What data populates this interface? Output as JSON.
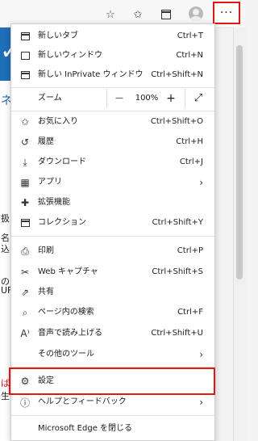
{
  "toolbar": {
    "icons": [
      "add-to-favorites-icon",
      "favorites-icon",
      "collections-icon",
      "profile-icon",
      "more-icon"
    ],
    "more_label": "···"
  },
  "page": {
    "fragments": [
      "ネ",
      "扱",
      "名",
      "込",
      "の",
      "UF",
      "ば",
      "生"
    ]
  },
  "menu": {
    "new_tab": {
      "label": "新しいタブ",
      "shortcut": "Ctrl+T"
    },
    "new_window": {
      "label": "新しいウィンドウ",
      "shortcut": "Ctrl+N"
    },
    "new_inprivate": {
      "label": "新しい InPrivate ウィンドウ",
      "shortcut": "Ctrl+Shift+N"
    },
    "zoom": {
      "label": "ズーム",
      "minus": "—",
      "value": "100%",
      "plus": "+",
      "fullscreen": "⤢"
    },
    "favorites": {
      "label": "お気に入り",
      "shortcut": "Ctrl+Shift+O"
    },
    "history": {
      "label": "履歴",
      "shortcut": "Ctrl+H"
    },
    "downloads": {
      "label": "ダウンロード",
      "shortcut": "Ctrl+J"
    },
    "apps": {
      "label": "アプリ"
    },
    "extensions": {
      "label": "拡張機能"
    },
    "collections": {
      "label": "コレクション",
      "shortcut": "Ctrl+Shift+Y"
    },
    "print": {
      "label": "印刷",
      "shortcut": "Ctrl+P"
    },
    "web_capture": {
      "label": "Web キャプチャ",
      "shortcut": "Ctrl+Shift+S"
    },
    "share": {
      "label": "共有"
    },
    "find_on_page": {
      "label": "ページ内の検索",
      "shortcut": "Ctrl+F"
    },
    "read_aloud": {
      "label": "音声で読み上げる",
      "shortcut": "Ctrl+Shift+U"
    },
    "more_tools": {
      "label": "その他のツール"
    },
    "settings": {
      "label": "設定"
    },
    "help": {
      "label": "ヘルプとフィードバック"
    },
    "close_edge": {
      "label": "Microsoft Edge を閉じる"
    }
  },
  "colors": {
    "highlight": "#e01515",
    "page_header": "#1f6fb8"
  }
}
